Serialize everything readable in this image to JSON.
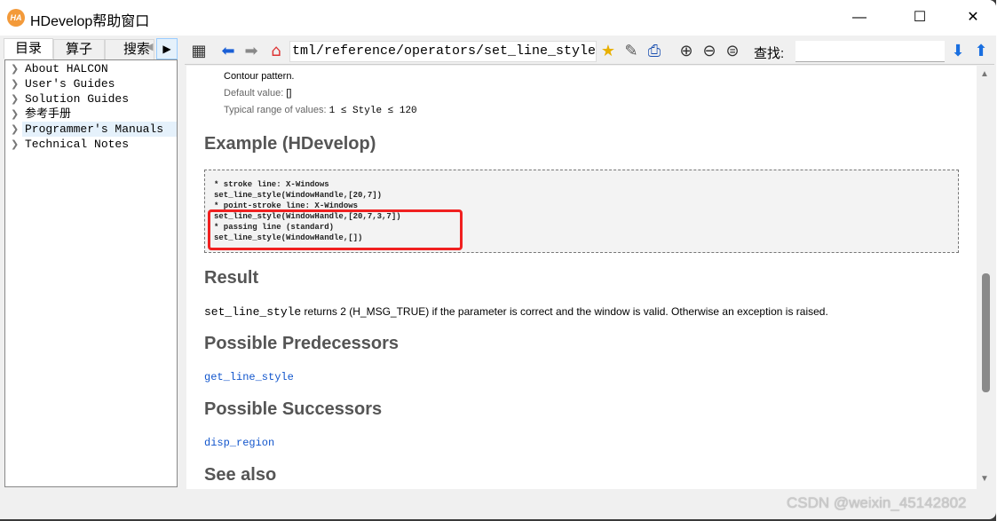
{
  "window": {
    "title": "HDevelop帮助窗口",
    "logo": "HA",
    "minimize": "—",
    "maximize": "☐",
    "close": "✕"
  },
  "tabs": [
    {
      "label": "目录"
    },
    {
      "label": "算子"
    },
    {
      "label": "搜索"
    }
  ],
  "tree": [
    {
      "label": "About HALCON"
    },
    {
      "label": "User's Guides"
    },
    {
      "label": "Solution Guides"
    },
    {
      "label": "参考手册"
    },
    {
      "label": "Programmer's Manuals"
    },
    {
      "label": "Technical Notes"
    }
  ],
  "toolbar": {
    "url": "tml/reference/operators/set_line_style.html",
    "find_label": "查找:",
    "find_value": ""
  },
  "content": {
    "param_desc": "Contour pattern.",
    "default_label": "Default value:",
    "default_value": "[]",
    "range_label": "Typical range of values:",
    "range_value": "1 ≤ Style ≤ 120",
    "example_heading": "Example (HDevelop)",
    "code": [
      "* stroke line: X-Windows",
      "set_line_style(WindowHandle,[20,7])",
      "* point-stroke line: X-Windows",
      "set_line_style(WindowHandle,[20,7,3,7])",
      "* passing line (standard)",
      "set_line_style(WindowHandle,[])"
    ],
    "result_heading": "Result",
    "result_op": "set_line_style",
    "result_text": " returns 2 (H_MSG_TRUE) if the parameter is correct and the window is valid. Otherwise an exception is raised.",
    "pred_heading": "Possible Predecessors",
    "pred_link": "get_line_style",
    "succ_heading": "Possible Successors",
    "succ_link": "disp_region",
    "see_heading": "See also"
  },
  "watermark": "CSDN @weixin_45142802",
  "scroll_position_percent": 50
}
